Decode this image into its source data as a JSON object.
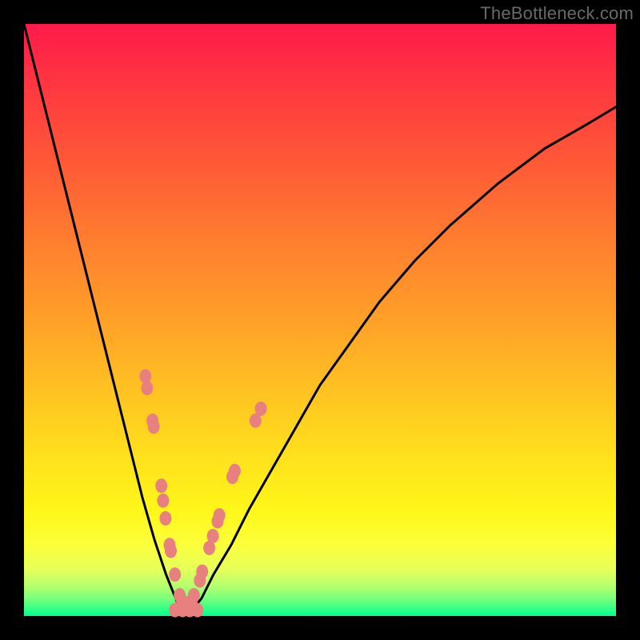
{
  "watermark": "TheBottleneck.com",
  "colors": {
    "frame": "#000000",
    "gradient_top": "#ff1a4a",
    "gradient_bottom": "#00ff8b",
    "curve_stroke": "#000000",
    "marker_fill": "#e98080"
  },
  "chart_data": {
    "type": "line",
    "title": "",
    "xlabel": "",
    "ylabel": "",
    "xlim": [
      0,
      100
    ],
    "ylim": [
      0,
      100
    ],
    "note": "Axes are unlabeled in the image. x/y are nominal 0–100; y appears to represent bottleneck magnitude where 0 is optimal (green bottom) and higher values are worse (red top). The curve is a V-shaped profile with its minimum near x≈27, y≈0.",
    "series": [
      {
        "name": "bottleneck-curve",
        "x": [
          0,
          2,
          4,
          6,
          8,
          10,
          12,
          14,
          16,
          18,
          20,
          22,
          24,
          26,
          27,
          28,
          30,
          32,
          35,
          38,
          42,
          46,
          50,
          55,
          60,
          66,
          72,
          80,
          88,
          95,
          100
        ],
        "y": [
          100,
          92,
          84,
          76,
          68,
          60,
          52,
          44,
          36,
          28,
          20,
          13,
          7,
          2,
          0,
          0.5,
          3,
          7,
          12,
          18,
          25,
          32,
          39,
          46,
          53,
          60,
          66,
          73,
          79,
          83,
          86
        ]
      }
    ],
    "markers": {
      "name": "scatter-points",
      "points": [
        {
          "x": 20.5,
          "y": 40.5
        },
        {
          "x": 20.8,
          "y": 38.5
        },
        {
          "x": 21.7,
          "y": 33.0
        },
        {
          "x": 21.9,
          "y": 32.0
        },
        {
          "x": 23.2,
          "y": 22.0
        },
        {
          "x": 23.5,
          "y": 19.5
        },
        {
          "x": 23.9,
          "y": 16.5
        },
        {
          "x": 24.6,
          "y": 12.0
        },
        {
          "x": 24.8,
          "y": 11.0
        },
        {
          "x": 25.5,
          "y": 7.0
        },
        {
          "x": 26.3,
          "y": 3.5
        },
        {
          "x": 26.7,
          "y": 2.5
        },
        {
          "x": 25.5,
          "y": 1.0
        },
        {
          "x": 26.8,
          "y": 1.0
        },
        {
          "x": 28.0,
          "y": 1.0
        },
        {
          "x": 29.3,
          "y": 1.0
        },
        {
          "x": 28.3,
          "y": 2.5
        },
        {
          "x": 28.7,
          "y": 3.5
        },
        {
          "x": 29.7,
          "y": 6.0
        },
        {
          "x": 30.1,
          "y": 7.5
        },
        {
          "x": 31.3,
          "y": 11.5
        },
        {
          "x": 31.9,
          "y": 13.5
        },
        {
          "x": 32.7,
          "y": 16.0
        },
        {
          "x": 33.0,
          "y": 17.0
        },
        {
          "x": 35.2,
          "y": 23.5
        },
        {
          "x": 35.6,
          "y": 24.5
        },
        {
          "x": 39.1,
          "y": 33.0
        },
        {
          "x": 40.0,
          "y": 35.0
        }
      ]
    }
  }
}
